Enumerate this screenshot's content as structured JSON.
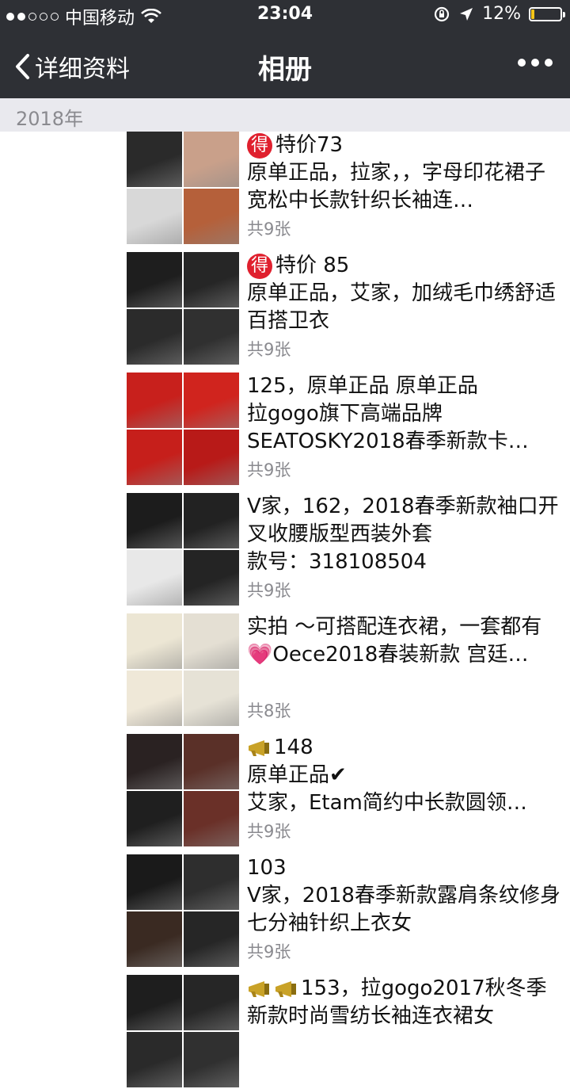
{
  "status_bar": {
    "carrier": "中国移动",
    "time": "23:04",
    "battery": "12%",
    "battery_level": 0.12,
    "signal_dots_filled": 2,
    "signal_dots_total": 5
  },
  "nav": {
    "back_label": "详细资料",
    "title": "相册",
    "more_icon": "more-dots-icon"
  },
  "year_label": "2018年",
  "entries": [
    {
      "badge": "得",
      "caption": "特价73\n原单正品，拉家，，字母印花裙子宽松中长款针织长袖连…",
      "count": "共9张",
      "thumb_colors": [
        "#2a2a2a",
        "#c9a08a",
        "#d8d8d8",
        "#b5603a"
      ]
    },
    {
      "badge": "得",
      "caption": "特价 85\n原单正品，艾家，加绒毛巾绣舒适百搭卫衣",
      "count": "共9张",
      "thumb_colors": [
        "#1e1e1e",
        "#262626",
        "#2b2b2b",
        "#303030"
      ]
    },
    {
      "badge": "",
      "caption": "125，原单正品   原单正品\n拉gogo旗下高端品牌\nSEATOSKY2018春季新款卡…",
      "count": "共9张",
      "thumb_colors": [
        "#c8201c",
        "#d0241e",
        "#c61f1b",
        "#b81a18"
      ]
    },
    {
      "badge": "",
      "caption": "V家，162，2018春季新款袖口开叉收腰版型西装外套\n款号：318108504",
      "count": "共9张",
      "thumb_colors": [
        "#1c1c1c",
        "#222222",
        "#e8e8e8",
        "#242424"
      ]
    },
    {
      "badge": "",
      "caption": "实拍 ～可搭配连衣裙，一套都有\n💗Oece2018春装新款 宫廷…",
      "count": "共8张",
      "thumb_colors": [
        "#ece6d4",
        "#e4dfd3",
        "#efe8d8",
        "#e6e2d6"
      ]
    },
    {
      "badge": "horn1",
      "caption": "148\n原单正品✔\n艾家，Etam简约中长款圆领…",
      "count": "共9张",
      "thumb_colors": [
        "#2a2222",
        "#5a3028",
        "#1f1f1f",
        "#6a3028"
      ]
    },
    {
      "badge": "",
      "caption": "103\nV家，2018春季新款露肩条纹修身七分袖针织上衣女",
      "count": "共9张",
      "thumb_colors": [
        "#1a1a1a",
        "#2e2e2e",
        "#3a2a22",
        "#262626"
      ]
    },
    {
      "badge": "horn2",
      "caption": "153，拉gogo2017秋冬季新款时尚雪纺长袖连衣裙女",
      "count": "",
      "thumb_colors": [
        "#1e1e1e",
        "#262626",
        "#2a2a2a",
        "#303030"
      ]
    }
  ]
}
